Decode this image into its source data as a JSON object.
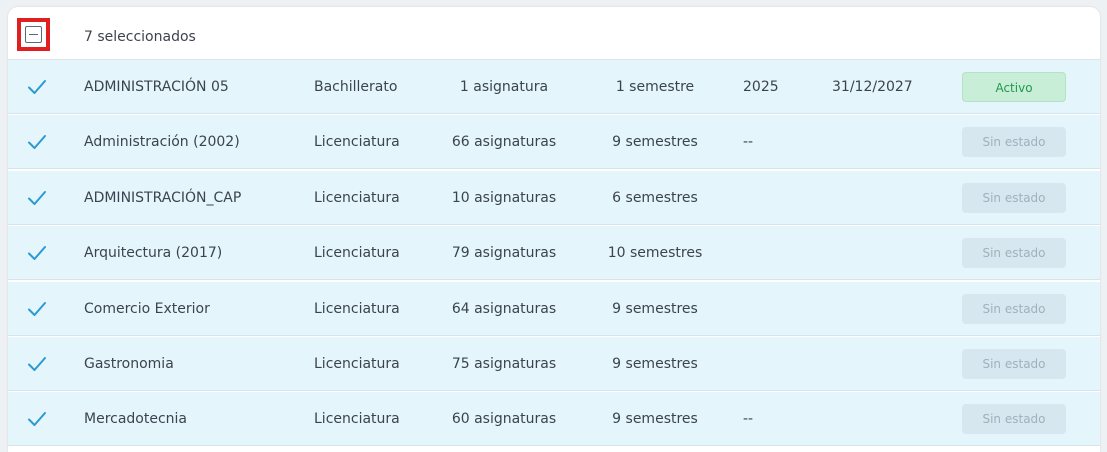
{
  "header": {
    "selected_label": "7 seleccionados"
  },
  "colors": {
    "row_selected_bg": "#e4f5fc",
    "check_accent": "#2b9ad1",
    "highlight_border": "#e02020",
    "badge_active_bg": "#c9eed8",
    "badge_active_text": "#1e9a4d",
    "badge_none_bg": "#d7e7ef",
    "badge_none_text": "#9fb1bd"
  },
  "rows": [
    {
      "name": "ADMINISTRACIÓN 05",
      "level": "Bachillerato",
      "subjects": "1 asignatura",
      "semesters": "1 semestre",
      "year": "2025",
      "date": "31/12/2027",
      "status": "Activo",
      "status_kind": "active",
      "checked": true
    },
    {
      "name": "Administración (2002)",
      "level": "Licenciatura",
      "subjects": "66 asignaturas",
      "semesters": "9 semestres",
      "year": "--",
      "date": "",
      "status": "Sin estado",
      "status_kind": "none",
      "checked": true
    },
    {
      "name": "ADMINISTRACIÓN_CAP",
      "level": "Licenciatura",
      "subjects": "10 asignaturas",
      "semesters": "6 semestres",
      "year": "",
      "date": "",
      "status": "Sin estado",
      "status_kind": "none",
      "checked": true
    },
    {
      "name": "Arquitectura (2017)",
      "level": "Licenciatura",
      "subjects": "79 asignaturas",
      "semesters": "10 semestres",
      "year": "",
      "date": "",
      "status": "Sin estado",
      "status_kind": "none",
      "checked": true
    },
    {
      "name": "Comercio Exterior",
      "level": "Licenciatura",
      "subjects": "64 asignaturas",
      "semesters": "9 semestres",
      "year": "",
      "date": "",
      "status": "Sin estado",
      "status_kind": "none",
      "checked": true
    },
    {
      "name": "Gastronomia",
      "level": "Licenciatura",
      "subjects": "75 asignaturas",
      "semesters": "9 semestres",
      "year": "",
      "date": "",
      "status": "Sin estado",
      "status_kind": "none",
      "checked": true
    },
    {
      "name": "Mercadotecnia",
      "level": "Licenciatura",
      "subjects": "60 asignaturas",
      "semesters": "9 semestres",
      "year": "--",
      "date": "",
      "status": "Sin estado",
      "status_kind": "none",
      "checked": true
    }
  ]
}
